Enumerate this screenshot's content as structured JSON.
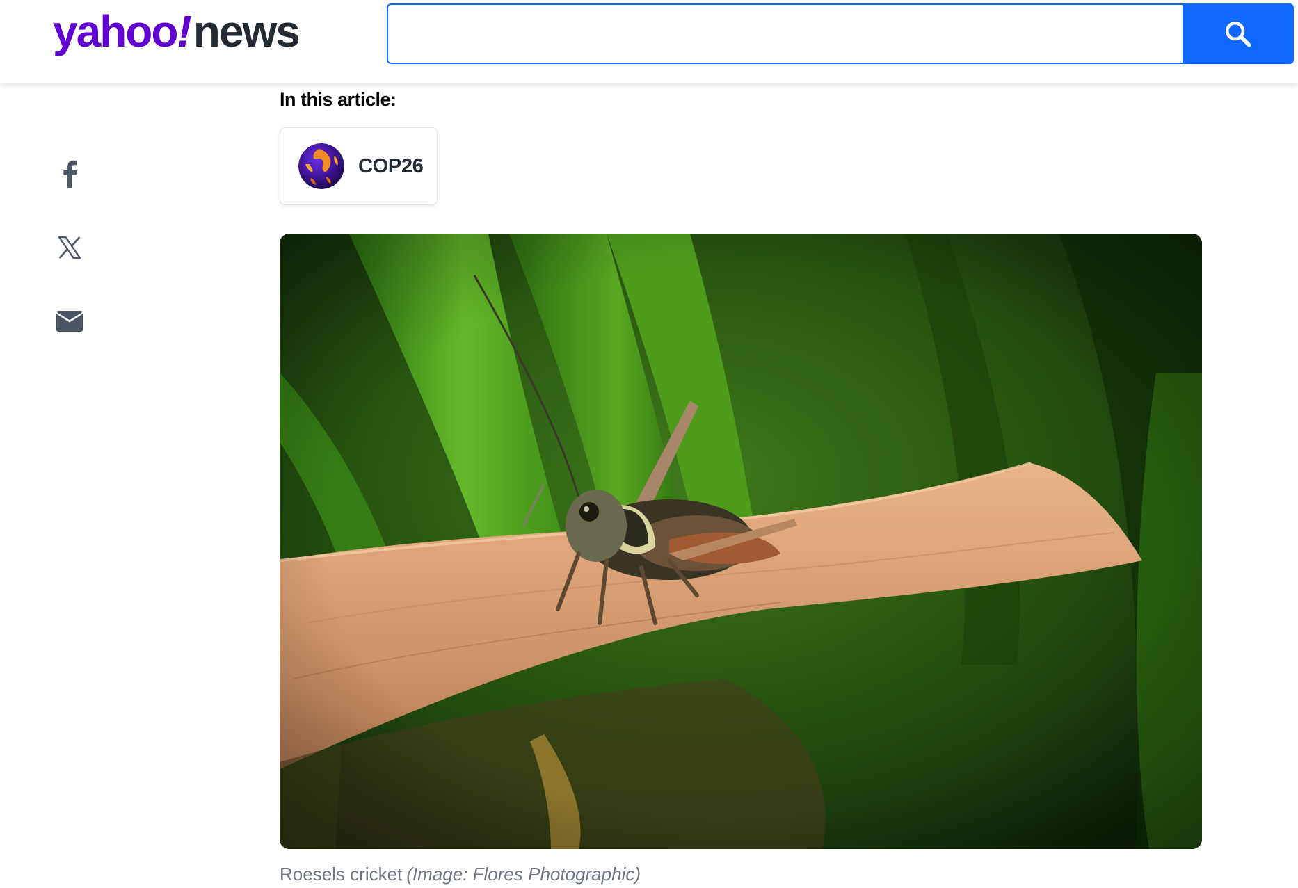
{
  "header": {
    "logo_brand": "yahoo",
    "logo_bang": "!",
    "logo_section": "news",
    "search": {
      "value": "",
      "placeholder": ""
    },
    "search_button_icon": "search-icon"
  },
  "share": {
    "items": [
      {
        "icon": "facebook-icon"
      },
      {
        "icon": "x-icon"
      },
      {
        "icon": "mail-icon"
      }
    ]
  },
  "article": {
    "in_this_article_label": "In this article:",
    "topic": {
      "label": "COP26",
      "icon": "globe-icon"
    },
    "image": {
      "caption": "Roesels cricket",
      "credit": "(Image: Flores Photographic)"
    }
  },
  "colors": {
    "brand_purple": "#6001d2",
    "search_blue": "#0f69ff",
    "text_dark": "#232a31",
    "caption_gray": "#6e7780",
    "share_icon_gray": "#4b5563"
  }
}
